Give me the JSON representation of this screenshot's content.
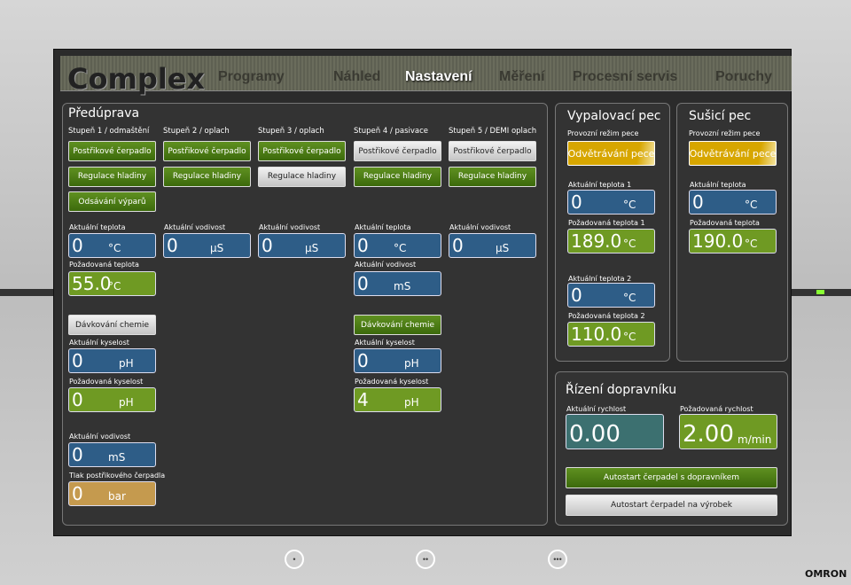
{
  "app": {
    "logo": "Complex",
    "brand": "OMRON"
  },
  "nav": [
    {
      "label": "Programy"
    },
    {
      "label": "Náhled"
    },
    {
      "label": "Nastavení",
      "active": true
    },
    {
      "label": "Měření"
    },
    {
      "label": "Procesní servis"
    },
    {
      "label": "Poruchy"
    }
  ],
  "colors": {
    "actual": "#2e5d87",
    "setpoint": "#6f9a23",
    "pressure": "#c59a4e",
    "speed": "#3c7070",
    "active_button": "#4a7a14",
    "mode_button": "#d7a600"
  },
  "pretreatment": {
    "title": "Předúprava",
    "stages": [
      {
        "title": "Stupeň 1 / odmaštění",
        "buttons": [
          {
            "label": "Postřikové čerpadlo",
            "on": true
          },
          {
            "label": "Regulace hladiny",
            "on": true
          },
          {
            "label": "Odsávání výparů",
            "on": true
          }
        ]
      },
      {
        "title": "Stupeň 2 / oplach",
        "buttons": [
          {
            "label": "Postřikové čerpadlo",
            "on": true
          },
          {
            "label": "Regulace hladiny",
            "on": true
          }
        ]
      },
      {
        "title": "Stupeň 3 / oplach",
        "buttons": [
          {
            "label": "Postřikové čerpadlo",
            "on": true
          },
          {
            "label": "Regulace hladiny",
            "on": false
          }
        ]
      },
      {
        "title": "Stupeň 4 / pasivace",
        "buttons": [
          {
            "label": "Postřikové čerpadlo",
            "on": false
          },
          {
            "label": "Regulace hladiny",
            "on": true
          }
        ]
      },
      {
        "title": "Stupeň 5 / DEMI oplach",
        "buttons": [
          {
            "label": "Postřikové čerpadlo",
            "on": false
          },
          {
            "label": "Regulace hladiny",
            "on": true
          }
        ]
      }
    ],
    "dosing": [
      {
        "label": "Dávkování chemie",
        "on": false
      },
      {
        "label": "Dávkování chemie",
        "on": true
      }
    ],
    "fields": [
      {
        "label": "Aktuální teplota",
        "value": "0",
        "unit": "°C"
      },
      {
        "label": "Požadovaná teplota",
        "value": "55.0",
        "unit": "°C"
      },
      {
        "label": "Aktuální kyselost",
        "value": "0",
        "unit": "pH"
      },
      {
        "label": "Požadovaná kyselost",
        "value": "0",
        "unit": "pH"
      },
      {
        "label": "Aktuální vodivost",
        "value": "0",
        "unit": "mS"
      },
      {
        "label": "Tlak postřikového čerpadla",
        "value": "0",
        "unit": "bar"
      },
      {
        "label": "Aktuální vodivost",
        "value": "0",
        "unit": "µS"
      },
      {
        "label": "Aktuální vodivost",
        "value": "0",
        "unit": "µS"
      },
      {
        "label": "Aktuální teplota",
        "value": "0",
        "unit": "°C"
      },
      {
        "label": "Aktuální vodivost",
        "value": "0",
        "unit": "mS"
      },
      {
        "label": "Aktuální kyselost",
        "value": "0",
        "unit": "pH"
      },
      {
        "label": "Požadovaná kyselost",
        "value": "4",
        "unit": "pH"
      },
      {
        "label": "Aktuální vodivost",
        "value": "0",
        "unit": "µS"
      }
    ]
  },
  "firing_oven": {
    "title": "Vypalovací pec",
    "mode_label": "Provozní režim pece",
    "mode": "Odvětrávání pece",
    "fields": [
      {
        "label": "Aktuální teplota 1",
        "value": "0",
        "unit": "°C"
      },
      {
        "label": "Požadovaná teplota 1",
        "value": "189.0",
        "unit": "°C"
      },
      {
        "label": "Aktuální teplota 2",
        "value": "0",
        "unit": "°C"
      },
      {
        "label": "Požadovaná teplota 2",
        "value": "110.0",
        "unit": "°C"
      }
    ]
  },
  "drying_oven": {
    "title": "Sušicí pec",
    "mode_label": "Provozní režim pece",
    "mode": "Odvětrávání pece",
    "fields": [
      {
        "label": "Aktuální teplota",
        "value": "0",
        "unit": "°C"
      },
      {
        "label": "Požadovaná teplota",
        "value": "190.0",
        "unit": "°C"
      }
    ]
  },
  "conveyor": {
    "title": "Řízení dopravníku",
    "fields": [
      {
        "label": "Aktuální rychlost",
        "value": "0.00",
        "unit": ""
      },
      {
        "label": "Požadovaná rychlost",
        "value": "2.00",
        "unit": "m/min"
      }
    ],
    "buttons": [
      {
        "label": "Autostart čerpadel s dopravníkem",
        "on": true
      },
      {
        "label": "Autostart čerpadel na výrobek",
        "on": false
      }
    ]
  }
}
